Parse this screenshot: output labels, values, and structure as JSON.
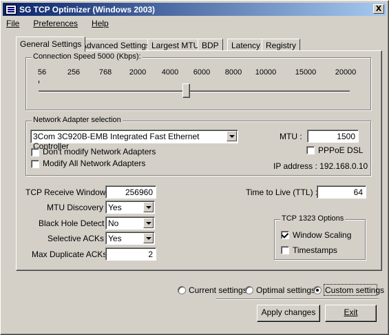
{
  "window": {
    "title": "SG TCP Optimizer (Windows 2003)",
    "close_glyph": "X"
  },
  "menu": [
    {
      "label": "File"
    },
    {
      "label": "Preferences"
    },
    {
      "label": "Help"
    }
  ],
  "tabs": [
    {
      "label": "General Settings",
      "active": true
    },
    {
      "label": "Advanced Settings"
    },
    {
      "label": "Largest MTU"
    },
    {
      "label": "BDP"
    },
    {
      "label": "Latency"
    },
    {
      "label": "Registry"
    }
  ],
  "connection_speed": {
    "legend": "Connection Speed  5000 (Kbps):",
    "ticks": [
      "56",
      "256",
      "768",
      "2000",
      "4000",
      "6000",
      "8000",
      "10000",
      "15000",
      "20000"
    ],
    "slider_value": 5000
  },
  "adapter": {
    "legend": "Network Adapter selection",
    "selected": "3Com 3C920B-EMB Integrated Fast Ethernet Controller",
    "dont_modify_label": "Don't modify Network Adapters",
    "modify_all_label": "Modify All Network Adapters",
    "mtu_label": "MTU :",
    "mtu_value": "1500",
    "pppoe_label": "PPPoE DSL",
    "ip_label": "IP address : 192.168.0.10"
  },
  "settings": {
    "tcp_window_label": "TCP Receive Window :",
    "tcp_window_value": "256960",
    "mtu_discovery_label": "MTU Discovery :",
    "mtu_discovery_value": "Yes",
    "black_hole_label": "Black Hole Detect :",
    "black_hole_value": "No",
    "selective_acks_label": "Selective ACKs :",
    "selective_acks_value": "Yes",
    "max_dup_acks_label": "Max Duplicate ACKs :",
    "max_dup_acks_value": "2",
    "ttl_label": "Time to Live (TTL) :",
    "ttl_value": "64"
  },
  "tcp1323": {
    "legend": "TCP 1323 Options",
    "window_scaling_label": "Window Scaling",
    "window_scaling_checked": true,
    "timestamps_label": "Timestamps",
    "timestamps_checked": false
  },
  "mode": {
    "current_label": "Current settings",
    "optimal_label": "Optimal settings",
    "custom_label": "Custom settings",
    "selected": "custom"
  },
  "buttons": {
    "apply_label": "Apply changes",
    "exit_label": "Exit"
  }
}
